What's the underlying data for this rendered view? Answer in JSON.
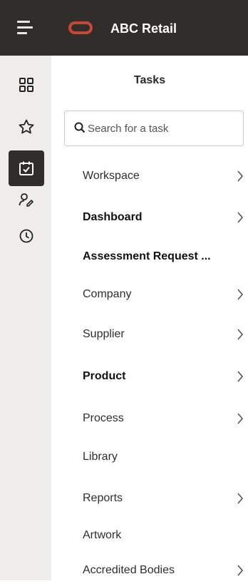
{
  "header": {
    "menu_icon": "hamburger-icon",
    "logo_icon": "oracle-logo",
    "app_title": "ABC Retail"
  },
  "rail": {
    "items": [
      {
        "name": "grid-icon",
        "active": false
      },
      {
        "name": "star-icon",
        "active": false
      },
      {
        "name": "tasks-calendar-icon",
        "active": true
      },
      {
        "name": "users-icon",
        "active": false
      },
      {
        "name": "clock-icon",
        "active": false
      }
    ]
  },
  "panel": {
    "title": "Tasks"
  },
  "search": {
    "placeholder": "Search for a task"
  },
  "tasks": [
    {
      "label": "Workspace",
      "has_submenu": true
    },
    {
      "label": "Dashboard",
      "has_submenu": true
    },
    {
      "label": "Assessment Request ...",
      "has_submenu": false
    },
    {
      "label": "Company",
      "has_submenu": true
    },
    {
      "label": "Supplier",
      "has_submenu": true
    },
    {
      "label": "Product",
      "has_submenu": true
    },
    {
      "label": "Process",
      "has_submenu": true
    },
    {
      "label": "Library",
      "has_submenu": false
    },
    {
      "label": "Reports",
      "has_submenu": true
    },
    {
      "label": "Artwork",
      "has_submenu": false
    },
    {
      "label": "Accredited Bodies",
      "has_submenu": true
    }
  ],
  "colors": {
    "header_bg": "#312d2a",
    "logo": "#c74634",
    "rail_bg": "#eeedeb"
  }
}
